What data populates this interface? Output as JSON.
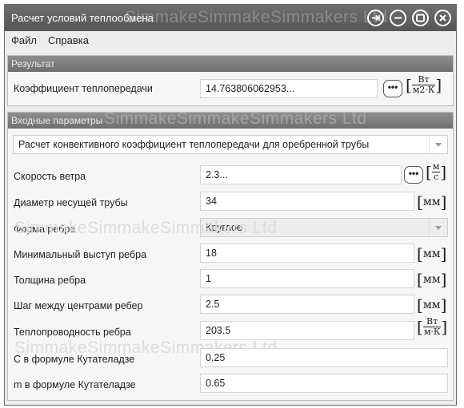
{
  "window": {
    "title": "Расчет условий теплообмена",
    "watermark": "SimmakeSimmakeSimmakers Ltd"
  },
  "titlebar_buttons": [
    {
      "name": "pin-icon"
    },
    {
      "name": "minimize-icon"
    },
    {
      "name": "maximize-icon"
    },
    {
      "name": "close-icon"
    }
  ],
  "menu": {
    "file": "Файл",
    "help": "Справка"
  },
  "result": {
    "header": "Результат",
    "label": "Коэффициент теплопередачи",
    "value": "14.763806062953...",
    "dots": "•••",
    "unit_num": "Вт",
    "unit_den": "м2·К"
  },
  "inputs": {
    "header": "Входные параметры",
    "calc_type": "Расчет конвективного коэффициент теплопередачи для оребренной трубы",
    "wind_speed": {
      "label": "Скорость ветра",
      "value": "2.3...",
      "dots": "•••",
      "unit_num": "м",
      "unit_den": "с"
    },
    "pipe_diameter": {
      "label": "Диаметр несущей трубы",
      "value": "34",
      "unit": "мм"
    },
    "fin_shape": {
      "label": "Форма ребра",
      "value": "Круглое"
    },
    "fin_min_protrusion": {
      "label": "Минимальный выступ ребра",
      "value": "18",
      "unit": "мм"
    },
    "fin_thickness": {
      "label": "Толщина ребра",
      "value": "1",
      "unit": "мм"
    },
    "fin_pitch": {
      "label": "Шаг между центрами ребер",
      "value": "2.5",
      "unit": "мм"
    },
    "fin_conductivity": {
      "label": "Теплопроводность ребра",
      "value": "203.5",
      "unit_num": "Вт",
      "unit_den": "м·К"
    },
    "kutateladze_c": {
      "label": "С в формуле Кутателадзе",
      "value": "0.25"
    },
    "kutateladze_m": {
      "label": "m в формуле Кутателадзе",
      "value": "0.65"
    }
  }
}
